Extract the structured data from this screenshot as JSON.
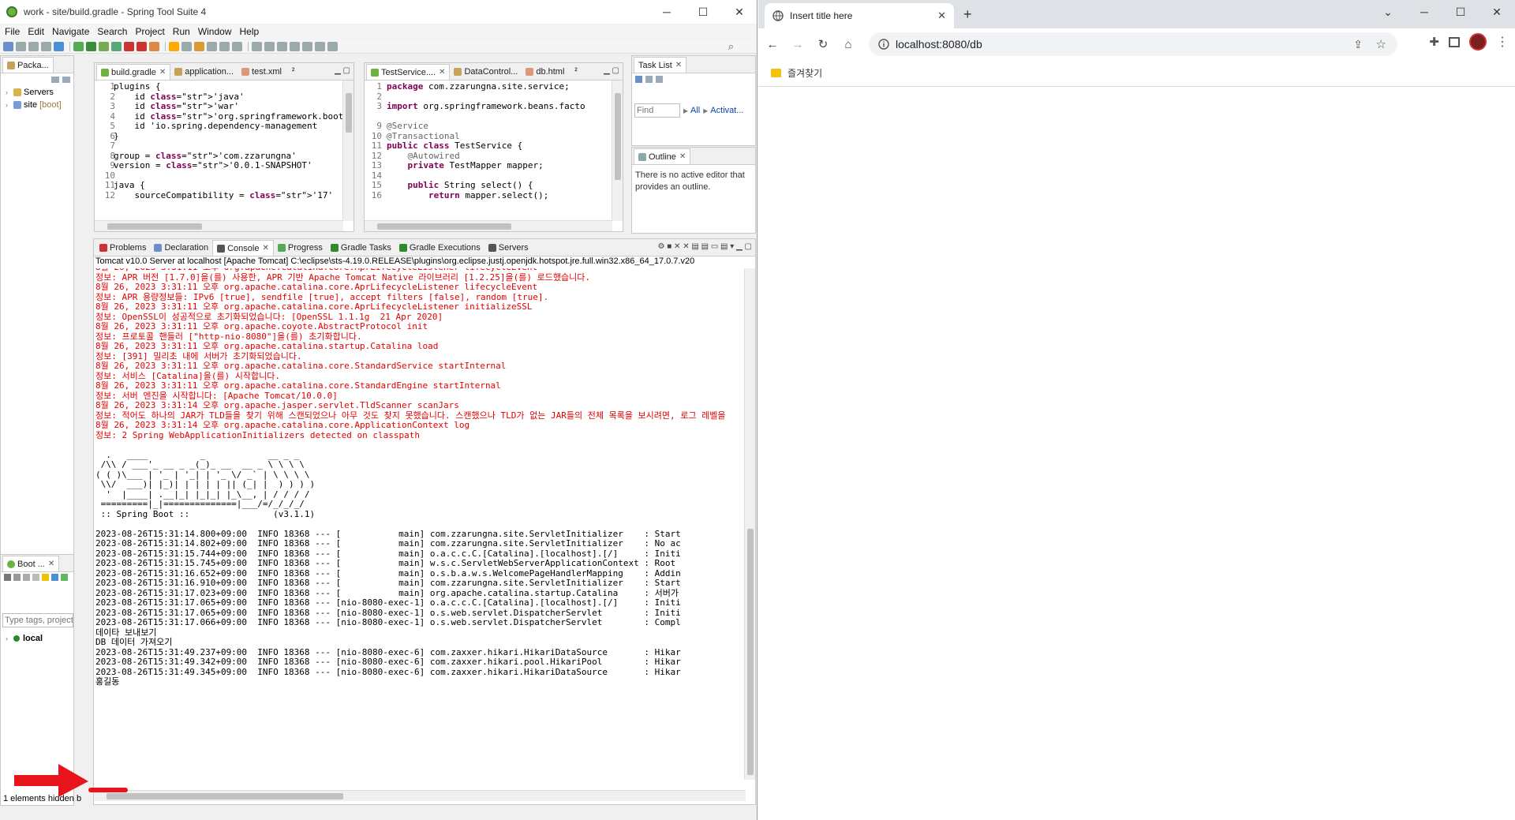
{
  "eclipse": {
    "title": "work - site/build.gradle - Spring Tool Suite 4",
    "menu": [
      "File",
      "Edit",
      "Navigate",
      "Search",
      "Project",
      "Run",
      "Window",
      "Help"
    ],
    "package_explorer": {
      "tab": "Packa...",
      "items": [
        {
          "label": "Servers",
          "suffix": ""
        },
        {
          "label": "site",
          "suffix": "[boot]"
        }
      ]
    },
    "editor_left": {
      "tabs": [
        "build.gradle",
        "application...",
        "test.xml"
      ],
      "overflow": "²",
      "line_numbers": [
        "1",
        "2",
        "3",
        "4",
        "5",
        "6",
        "7",
        "8",
        "9",
        "10",
        "11",
        "12"
      ],
      "lines": [
        "plugins {",
        "    id 'java'",
        "    id 'war'",
        "    id 'org.springframework.boot' versi",
        "    id 'io.spring.dependency-management",
        "}",
        "",
        "group = 'com.zzarungna'",
        "version = '0.0.1-SNAPSHOT'",
        "",
        "java {",
        "    sourceCompatibility = '17'"
      ]
    },
    "editor_right": {
      "tabs": [
        "TestService....",
        "DataControl...",
        "db.html"
      ],
      "overflow": "²",
      "line_numbers": [
        "1",
        "2",
        "3",
        "9",
        "10",
        "11",
        "12",
        "13",
        "14",
        "15",
        "16"
      ],
      "lines": [
        "package com.zzarungna.site.service;",
        "",
        "import org.springframework.beans.facto",
        "",
        "@Service",
        "@Transactional",
        "public class TestService {",
        "    @Autowired",
        "    private TestMapper mapper;",
        "",
        "    public String select() {",
        "        return mapper.select();"
      ]
    },
    "task_list": {
      "tab": "Task List",
      "find_placeholder": "Find",
      "all_label": "All",
      "activate_label": "Activat..."
    },
    "outline": {
      "tab": "Outline",
      "message": "There is no active editor that provides an outline."
    },
    "boot_dashboard": {
      "tab": "Boot ...",
      "filter_placeholder": "Type tags, projects,",
      "item": "local",
      "status": "1 elements hidden b"
    },
    "console": {
      "tabs": [
        "Problems",
        "Declaration",
        "Console",
        "Progress",
        "Gradle Tasks",
        "Gradle Executions",
        "Servers"
      ],
      "header": "Tomcat v10.0 Server at localhost [Apache Tomcat] C:\\eclipse\\sts-4.19.0.RELEASE\\plugins\\org.eclipse.justj.openjdk.hotspot.jre.full.win32.x86_64_17.0.7.v20",
      "red_lines": [
        "8월 26, 2023 3:31:11 오후 org.apache.catalina.core.AprLifecycleListener lifecycleEvent",
        "정보: APR 버전 [1.7.0]을(를) 사용한, APR 기반 Apache Tomcat Native 라이브러리 [1.2.25]을(를) 로드했습니다.",
        "8월 26, 2023 3:31:11 오후 org.apache.catalina.core.AprLifecycleListener lifecycleEvent",
        "정보: APR 용량정보들: IPv6 [true], sendfile [true], accept filters [false], random [true].",
        "8월 26, 2023 3:31:11 오후 org.apache.catalina.core.AprLifecycleListener initializeSSL",
        "정보: OpenSSL이 성공적으로 초기화되었습니다: [OpenSSL 1.1.1g  21 Apr 2020]",
        "8월 26, 2023 3:31:11 오후 org.apache.coyote.AbstractProtocol init",
        "정보: 프로토콜 핸들러 [\"http-nio-8080\"]을(를) 초기화합니다.",
        "8월 26, 2023 3:31:11 오후 org.apache.catalina.startup.Catalina load",
        "정보: [391] 밀리초 내에 서버가 초기화되었습니다.",
        "8월 26, 2023 3:31:11 오후 org.apache.catalina.core.StandardService startInternal",
        "정보: 서비스 [Catalina]을(를) 시작합니다.",
        "8월 26, 2023 3:31:11 오후 org.apache.catalina.core.StandardEngine startInternal",
        "정보: 서버 엔진을 시작합니다: [Apache Tomcat/10.0.0]",
        "8월 26, 2023 3:31:14 오후 org.apache.jasper.servlet.TldScanner scanJars",
        "정보: 적어도 하나의 JAR가 TLD들을 찾기 위해 스캔되었으나 아무 것도 찾지 못했습니다. 스캔했으나 TLD가 없는 JAR들의 전체 목록을 보시려면, 로그 레벨을",
        "8월 26, 2023 3:31:14 오후 org.apache.catalina.core.ApplicationContext log",
        "정보: 2 Spring WebApplicationInitializers detected on classpath"
      ],
      "banner": [
        "",
        "  .   ____          _            __ _ _",
        " /\\\\ / ___'_ __ _ _(_)_ __  __ _ \\ \\ \\ \\",
        "( ( )\\___ | '_ | '_| | '_ \\/ _` | \\ \\ \\ \\",
        " \\\\/  ___)| |_)| | | | | || (_| |  ) ) ) )",
        "  '  |____| .__|_| |_|_| |_\\__, | / / / /",
        " =========|_|==============|___/=/_/_/_/",
        " :: Spring Boot ::                (v3.1.1)",
        ""
      ],
      "log_lines": [
        "2023-08-26T15:31:14.800+09:00  INFO 18368 --- [           main] com.zzarungna.site.ServletInitializer    : Start",
        "2023-08-26T15:31:14.802+09:00  INFO 18368 --- [           main] com.zzarungna.site.ServletInitializer    : No ac",
        "2023-08-26T15:31:15.744+09:00  INFO 18368 --- [           main] o.a.c.c.C.[Catalina].[localhost].[/]     : Initi",
        "2023-08-26T15:31:15.745+09:00  INFO 18368 --- [           main] w.s.c.ServletWebServerApplicationContext : Root ",
        "2023-08-26T15:31:16.652+09:00  INFO 18368 --- [           main] o.s.b.a.w.s.WelcomePageHandlerMapping    : Addin",
        "2023-08-26T15:31:16.910+09:00  INFO 18368 --- [           main] com.zzarungna.site.ServletInitializer    : Start",
        "2023-08-26T15:31:17.023+09:00  INFO 18368 --- [           main] org.apache.catalina.startup.Catalina     : 서버가",
        "2023-08-26T15:31:17.065+09:00  INFO 18368 --- [nio-8080-exec-1] o.a.c.c.C.[Catalina].[localhost].[/]     : Initi",
        "2023-08-26T15:31:17.065+09:00  INFO 18368 --- [nio-8080-exec-1] o.s.web.servlet.DispatcherServlet        : Initi",
        "2023-08-26T15:31:17.066+09:00  INFO 18368 --- [nio-8080-exec-1] o.s.web.servlet.DispatcherServlet        : Compl",
        "데이타 보내보기",
        "DB 데이터 가져오기",
        "2023-08-26T15:31:49.237+09:00  INFO 18368 --- [nio-8080-exec-6] com.zaxxer.hikari.HikariDataSource       : Hikar",
        "2023-08-26T15:31:49.342+09:00  INFO 18368 --- [nio-8080-exec-6] com.zaxxer.hikari.pool.HikariPool        : Hikar",
        "2023-08-26T15:31:49.345+09:00  INFO 18368 --- [nio-8080-exec-6] com.zaxxer.hikari.HikariDataSource       : Hikar",
        "홍길동"
      ]
    }
  },
  "chrome": {
    "tab_title": "Insert title here",
    "url": "localhost:8080/db",
    "bookmark": "즐겨찾기"
  },
  "colors": {
    "console_red": "#e30000",
    "arrow_red": "#e8141c",
    "keyword": "#7f0055",
    "string": "#2a00ff"
  }
}
